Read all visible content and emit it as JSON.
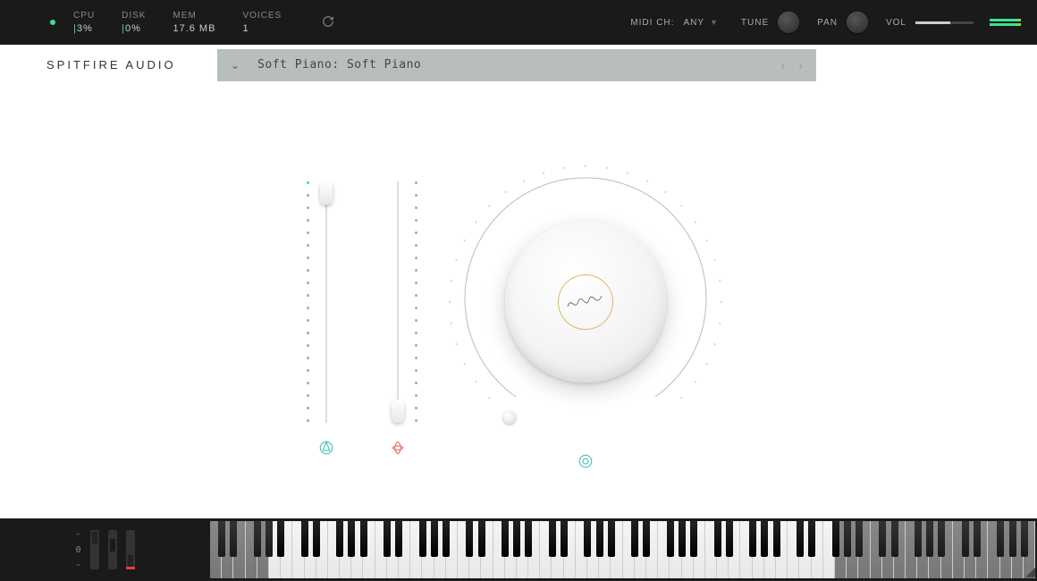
{
  "topbar": {
    "cpu": {
      "label": "CPU",
      "value": "3%"
    },
    "disk": {
      "label": "DISK",
      "value": "0%"
    },
    "mem": {
      "label": "MEM",
      "value": "17.6 MB"
    },
    "voices": {
      "label": "VOICES",
      "value": "1"
    },
    "midi_label": "MIDI CH:",
    "midi_value": "ANY",
    "tune_label": "TUNE",
    "pan_label": "PAN",
    "vol_label": "VOL"
  },
  "brand": "SPITFIRE AUDIO",
  "preset": {
    "name": "Soft Piano: Soft Piano"
  },
  "velocity": {
    "value": "0"
  },
  "controls": {
    "slider1": {
      "name": "expression",
      "position": "top"
    },
    "slider2": {
      "name": "dynamics",
      "position": "bottom"
    },
    "knob": {
      "name": "reverb"
    }
  },
  "colors": {
    "accent_green": "#3ee08f",
    "accent_red": "#e04040",
    "accent_gold": "#d9b85a",
    "accent_teal": "#4ac0c0",
    "accent_rose": "#d86b6b"
  }
}
